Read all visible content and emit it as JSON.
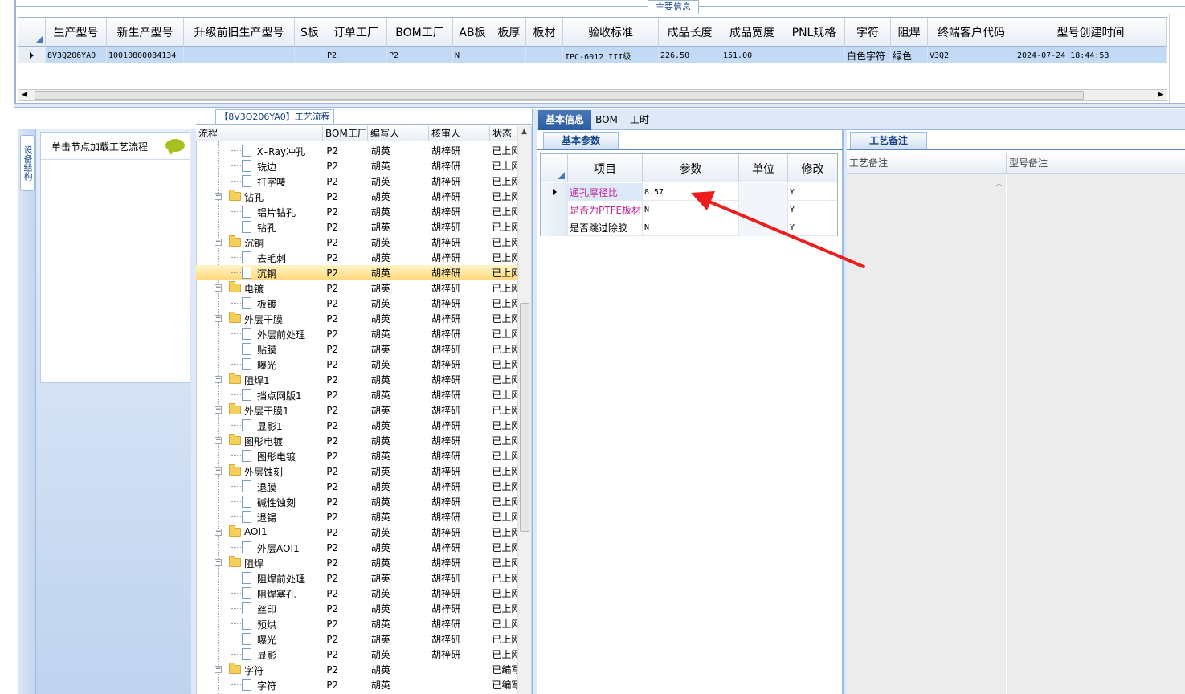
{
  "main_info": {
    "legend": "主要信息",
    "columns": [
      "生产型号",
      "新生产型号",
      "升级前旧生产型号",
      "S板",
      "订单工厂",
      "BOM工厂",
      "AB板",
      "板厚",
      "板材",
      "验收标准",
      "成品长度",
      "成品宽度",
      "PNL规格",
      "字符",
      "阻焊",
      "终端客户代码",
      "型号创建时间"
    ],
    "row": {
      "prod_model": "8V3Q206YA0",
      "new_model": "10010800084134",
      "old_model": "",
      "s_board": "",
      "order_factory": "P2",
      "bom_factory": "P2",
      "ab_board": "N",
      "thickness": "",
      "material": "",
      "acceptance": "IPC-6012 III级",
      "length": "226.50",
      "width": "151.00",
      "pnl": "",
      "char": "白色字符",
      "solder": "绿色",
      "customer_code": "V3Q2",
      "created": "2024-07-24 18:44:53"
    }
  },
  "left_panel": {
    "vtab_label": "设备结构",
    "load_hint": "单击节点加载工艺流程"
  },
  "tree": {
    "title": "【8V3Q206YA0】工艺流程",
    "headers": [
      "流程",
      "BOM工厂",
      "编写人",
      "核审人",
      "状态"
    ],
    "rows": [
      {
        "label": "X-Ray冲孔",
        "level": 2,
        "bom": "P2",
        "writer": "胡英",
        "reviewer": "胡梓研",
        "status": "已上网"
      },
      {
        "label": "铣边",
        "level": 2,
        "bom": "P2",
        "writer": "胡英",
        "reviewer": "胡梓研",
        "status": "已上网"
      },
      {
        "label": "打字唛",
        "level": 2,
        "bom": "P2",
        "writer": "胡英",
        "reviewer": "胡梓研",
        "status": "已上网"
      },
      {
        "label": "钻孔",
        "level": 1,
        "bom": "P2",
        "writer": "胡英",
        "reviewer": "胡梓研",
        "status": "已上网"
      },
      {
        "label": "铝片钻孔",
        "level": 2,
        "bom": "P2",
        "writer": "胡英",
        "reviewer": "胡梓研",
        "status": "已上网"
      },
      {
        "label": "钻孔",
        "level": 2,
        "bom": "P2",
        "writer": "胡英",
        "reviewer": "胡梓研",
        "status": "已上网"
      },
      {
        "label": "沉铜",
        "level": 1,
        "bom": "P2",
        "writer": "胡英",
        "reviewer": "胡梓研",
        "status": "已上网"
      },
      {
        "label": "去毛刺",
        "level": 2,
        "bom": "P2",
        "writer": "胡英",
        "reviewer": "胡梓研",
        "status": "已上网"
      },
      {
        "label": "沉铜",
        "level": 2,
        "bom": "P2",
        "writer": "胡英",
        "reviewer": "胡梓研",
        "status": "已上网",
        "selected": true
      },
      {
        "label": "电镀",
        "level": 1,
        "bom": "P2",
        "writer": "胡英",
        "reviewer": "胡梓研",
        "status": "已上网"
      },
      {
        "label": "板镀",
        "level": 2,
        "bom": "P2",
        "writer": "胡英",
        "reviewer": "胡梓研",
        "status": "已上网"
      },
      {
        "label": "外层干膜",
        "level": 1,
        "bom": "P2",
        "writer": "胡英",
        "reviewer": "胡梓研",
        "status": "已上网"
      },
      {
        "label": "外层前处理",
        "level": 2,
        "bom": "P2",
        "writer": "胡英",
        "reviewer": "胡梓研",
        "status": "已上网"
      },
      {
        "label": "贴膜",
        "level": 2,
        "bom": "P2",
        "writer": "胡英",
        "reviewer": "胡梓研",
        "status": "已上网"
      },
      {
        "label": "曝光",
        "level": 2,
        "bom": "P2",
        "writer": "胡英",
        "reviewer": "胡梓研",
        "status": "已上网"
      },
      {
        "label": "阻焊1",
        "level": 1,
        "bom": "P2",
        "writer": "胡英",
        "reviewer": "胡梓研",
        "status": "已上网"
      },
      {
        "label": "挡点网版1",
        "level": 2,
        "bom": "P2",
        "writer": "胡英",
        "reviewer": "胡梓研",
        "status": "已上网"
      },
      {
        "label": "外层干膜1",
        "level": 1,
        "bom": "P2",
        "writer": "胡英",
        "reviewer": "胡梓研",
        "status": "已上网"
      },
      {
        "label": "显影1",
        "level": 2,
        "bom": "P2",
        "writer": "胡英",
        "reviewer": "胡梓研",
        "status": "已上网"
      },
      {
        "label": "图形电镀",
        "level": 1,
        "bom": "P2",
        "writer": "胡英",
        "reviewer": "胡梓研",
        "status": "已上网"
      },
      {
        "label": "图形电镀",
        "level": 2,
        "bom": "P2",
        "writer": "胡英",
        "reviewer": "胡梓研",
        "status": "已上网"
      },
      {
        "label": "外层蚀刻",
        "level": 1,
        "bom": "P2",
        "writer": "胡英",
        "reviewer": "胡梓研",
        "status": "已上网"
      },
      {
        "label": "退膜",
        "level": 2,
        "bom": "P2",
        "writer": "胡英",
        "reviewer": "胡梓研",
        "status": "已上网"
      },
      {
        "label": "碱性蚀刻",
        "level": 2,
        "bom": "P2",
        "writer": "胡英",
        "reviewer": "胡梓研",
        "status": "已上网"
      },
      {
        "label": "退锡",
        "level": 2,
        "bom": "P2",
        "writer": "胡英",
        "reviewer": "胡梓研",
        "status": "已上网"
      },
      {
        "label": "AOI1",
        "level": 1,
        "bom": "P2",
        "writer": "胡英",
        "reviewer": "胡梓研",
        "status": "已上网"
      },
      {
        "label": "外层AOI1",
        "level": 2,
        "bom": "P2",
        "writer": "胡英",
        "reviewer": "胡梓研",
        "status": "已上网"
      },
      {
        "label": "阻焊",
        "level": 1,
        "bom": "P2",
        "writer": "胡英",
        "reviewer": "胡梓研",
        "status": "已上网"
      },
      {
        "label": "阻焊前处理",
        "level": 2,
        "bom": "P2",
        "writer": "胡英",
        "reviewer": "胡梓研",
        "status": "已上网"
      },
      {
        "label": "阻焊塞孔",
        "level": 2,
        "bom": "P2",
        "writer": "胡英",
        "reviewer": "胡梓研",
        "status": "已上网"
      },
      {
        "label": "丝印",
        "level": 2,
        "bom": "P2",
        "writer": "胡英",
        "reviewer": "胡梓研",
        "status": "已上网"
      },
      {
        "label": "预烘",
        "level": 2,
        "bom": "P2",
        "writer": "胡英",
        "reviewer": "胡梓研",
        "status": "已上网"
      },
      {
        "label": "曝光",
        "level": 2,
        "bom": "P2",
        "writer": "胡英",
        "reviewer": "胡梓研",
        "status": "已上网"
      },
      {
        "label": "显影",
        "level": 2,
        "bom": "P2",
        "writer": "胡英",
        "reviewer": "胡梓研",
        "status": "已上网"
      },
      {
        "label": "字符",
        "level": 1,
        "bom": "P2",
        "writer": "胡英",
        "reviewer": "",
        "status": "已编写"
      },
      {
        "label": "字符",
        "level": 2,
        "bom": "P2",
        "writer": "胡英",
        "reviewer": "",
        "status": "已编写"
      }
    ]
  },
  "right_tabs": [
    "基本信息",
    "BOM",
    "工时"
  ],
  "basic_params": {
    "tab": "基本参数",
    "headers": [
      "项目",
      "参数",
      "单位",
      "修改"
    ],
    "rows": [
      {
        "item": "通孔厚径比",
        "value": "8.57",
        "unit": "",
        "modify": "Y"
      },
      {
        "item": "是否为PTFE板材",
        "value": "N",
        "unit": "",
        "modify": "Y"
      },
      {
        "item": "是否跳过除胶",
        "value": "N",
        "unit": "",
        "modify": "Y"
      }
    ]
  },
  "remarks": {
    "tab": "工艺备注",
    "headers": [
      "工艺备注",
      "型号备注"
    ]
  },
  "colors": {
    "accent": "#2a5aa0",
    "selected_row": "#c3daf7",
    "tree_selected": "#ffd87a",
    "annotation_arrow": "#ee1c1c"
  }
}
